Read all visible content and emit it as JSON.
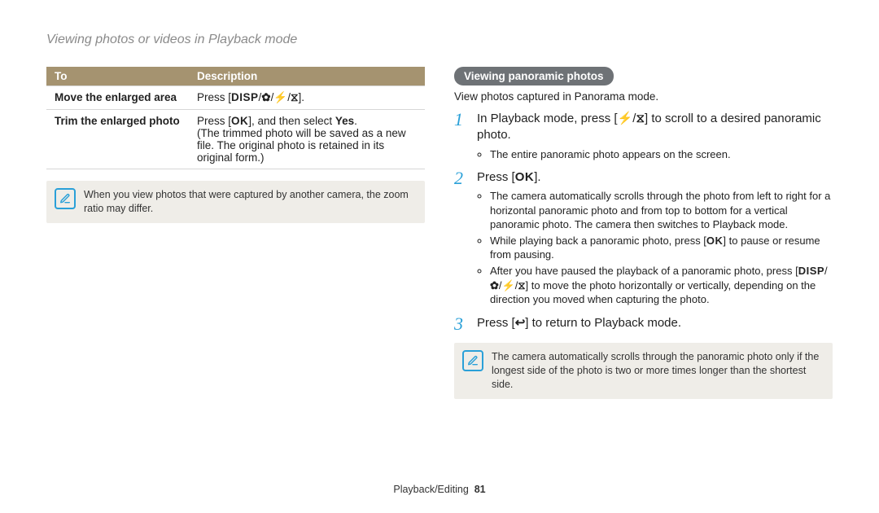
{
  "page_title": "Viewing photos or videos in Playback mode",
  "table": {
    "hdr_to": "To",
    "hdr_desc": "Description",
    "r1_to": "Move the enlarged area",
    "r1_desc_pre": "Press [",
    "r1_desc_post": "].",
    "r2_to": "Trim the enlarged photo",
    "r2_desc_a_pre": "Press [",
    "r2_desc_a_mid": "], and then select ",
    "r2_desc_a_yes": "Yes",
    "r2_desc_a_post": ".",
    "r2_desc_b": "(The trimmed photo will be saved as a new file. The original photo is retained in its original form.)"
  },
  "note_left": "When you view photos that were captured by another camera, the zoom ratio may differ.",
  "right": {
    "heading": "Viewing panoramic photos",
    "intro": "View photos captured in Panorama mode.",
    "s1_pre": "In Playback mode, press [",
    "s1_post": "] to scroll to a desired panoramic photo.",
    "s1_b1": "The entire panoramic photo appears on the screen.",
    "s2_pre": "Press [",
    "s2_post": "].",
    "s2_b1": "The camera automatically scrolls through the photo from left to right for a horizontal panoramic photo and from top to bottom for a vertical panoramic photo. The camera then switches to Playback mode.",
    "s2_b2_pre": "While playing back a panoramic photo, press [",
    "s2_b2_post": "] to pause or resume from pausing.",
    "s2_b3_pre": "After you have paused the playback of a panoramic photo, press [",
    "s2_b3_post": "] to move the photo horizontally or vertically, depending on the direction you moved when capturing the photo.",
    "s3_pre": "Press [",
    "s3_post": "] to return to Playback mode."
  },
  "note_right": "The camera automatically scrolls through the panoramic photo only if the longest side of the photo is two or more times longer than the shortest side.",
  "footer_section": "Playback/Editing",
  "footer_page": "81",
  "icons": {
    "disp": "DISP",
    "ok": "OK"
  }
}
